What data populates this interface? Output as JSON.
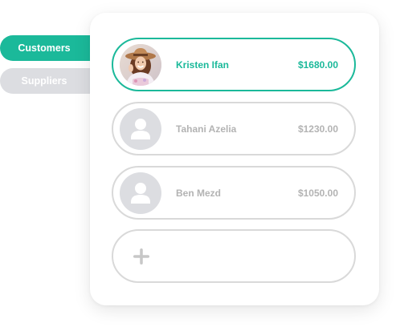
{
  "tabs": [
    {
      "label": "Customers",
      "active": true
    },
    {
      "label": "Suppliers",
      "active": false
    }
  ],
  "contacts": [
    {
      "name": "Kristen Ifan",
      "amount": "$1680.00",
      "selected": true,
      "avatar": "photo"
    },
    {
      "name": "Tahani Azelia",
      "amount": "$1230.00",
      "selected": false,
      "avatar": "user-placeholder-icon"
    },
    {
      "name": "Ben Mezd",
      "amount": "$1050.00",
      "selected": false,
      "avatar": "user-placeholder-icon"
    }
  ],
  "add_button": {
    "icon": "plus-icon"
  },
  "colors": {
    "accent": "#1bb99a",
    "inactive_tab": "#dcdde1",
    "muted_text": "#b3b3b3",
    "row_border": "#d9d9d9"
  }
}
